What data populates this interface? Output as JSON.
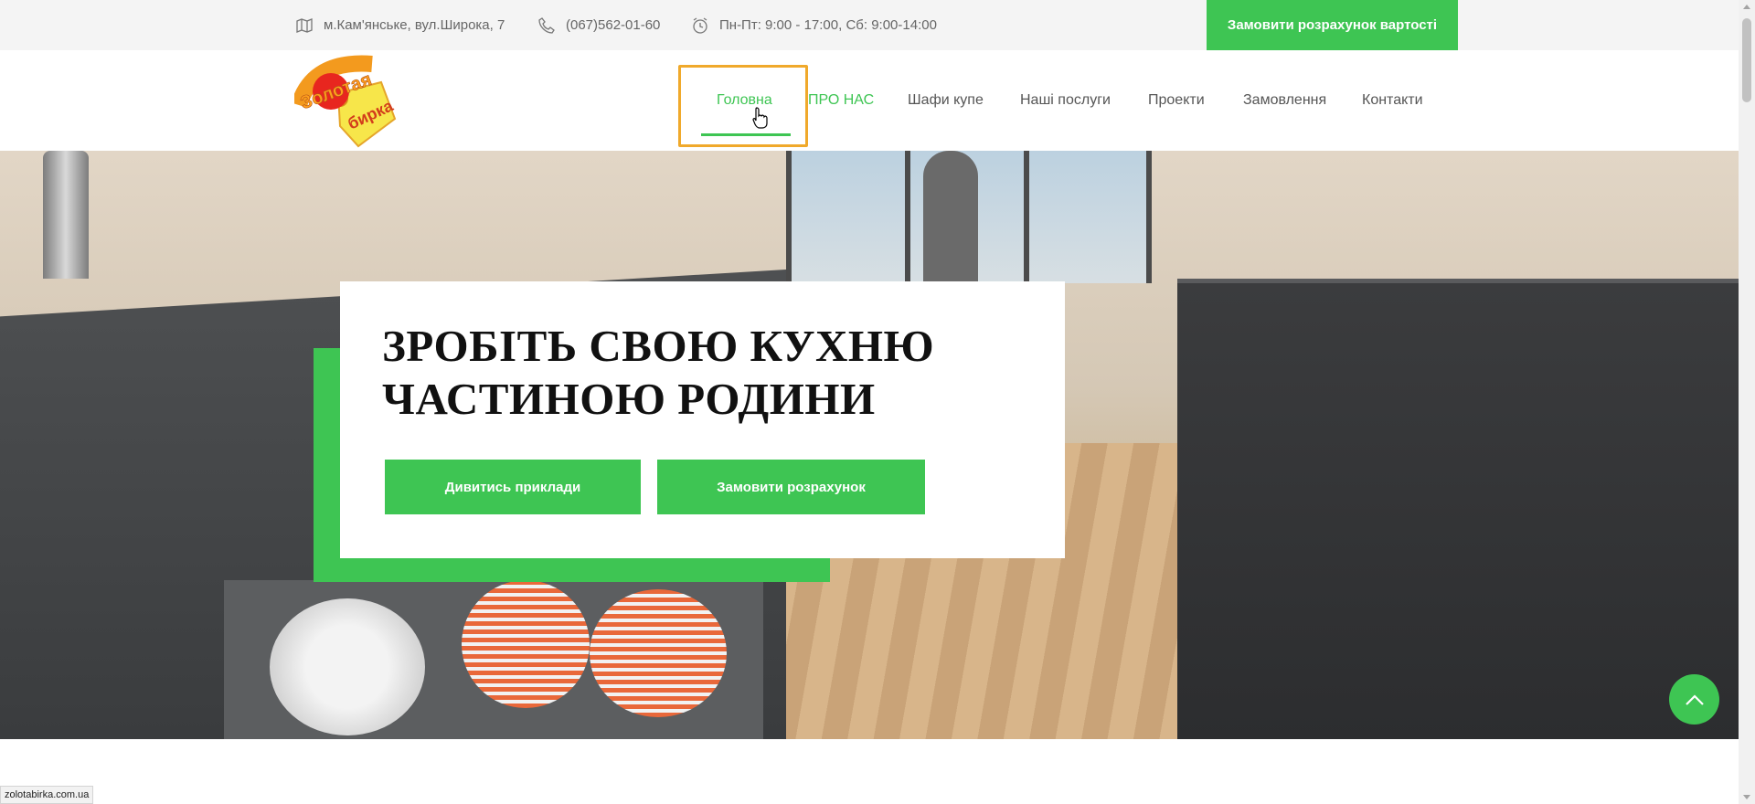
{
  "topbar": {
    "address": "м.Кам'янське, вул.Широка, 7",
    "phone": "(067)562-01-60",
    "hours": "Пн-Пт: 9:00 - 17:00, Сб: 9:00-14:00",
    "order_button": "Замовити розрахунок вартості",
    "icons": [
      "map-icon",
      "phone-icon",
      "clock-icon"
    ]
  },
  "nav": {
    "items": [
      {
        "label": "Головна",
        "active": true
      },
      {
        "label": "ПРО НАС"
      },
      {
        "label": "Шафи купе"
      },
      {
        "label": "Наші послуги"
      },
      {
        "label": "Проекти"
      },
      {
        "label": "Замовлення"
      },
      {
        "label": "Контакти"
      }
    ]
  },
  "logo": {
    "text_line1": "Золотая",
    "text_line2": "бирка"
  },
  "hero": {
    "headline": "ЗРОБІТЬ СВОЮ КУХНЮ ЧАСТИНОЮ РОДИНИ",
    "button_examples": "Дивитись приклади",
    "button_order": "Замовити розрахунок"
  },
  "status_url": "zolotabirka.com.ua",
  "colors": {
    "accent": "#3ec553",
    "focus_outline": "#f0a92b",
    "topbar_bg": "#f4f4f4",
    "headline": "#111111"
  }
}
